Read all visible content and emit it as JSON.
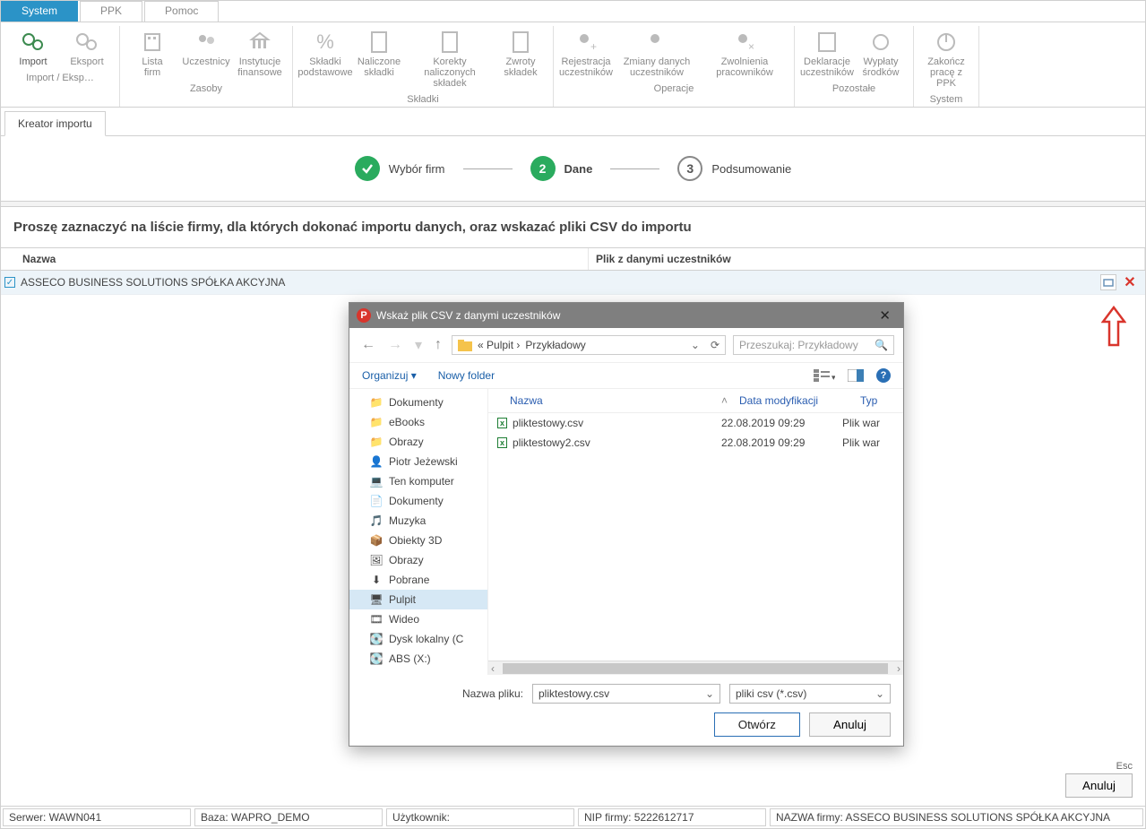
{
  "top_tabs": {
    "system": "System",
    "ppk": "PPK",
    "pomoc": "Pomoc"
  },
  "ribbon": {
    "groups": {
      "import_eksport": {
        "label": "Import / Eksp…",
        "items": [
          {
            "key": "import",
            "label": "Import"
          },
          {
            "key": "eksport",
            "label": "Eksport"
          }
        ]
      },
      "zasoby": {
        "label": "Zasoby",
        "items": [
          {
            "key": "lista_firm",
            "label": "Lista\nfirm"
          },
          {
            "key": "uczestnicy",
            "label": "Uczestnicy"
          },
          {
            "key": "instytucje",
            "label": "Instytucje\nfinansowe"
          }
        ]
      },
      "skladki": {
        "label": "Składki",
        "items": [
          {
            "key": "skladki_podst",
            "label": "Składki\npodstawowe"
          },
          {
            "key": "naliczone",
            "label": "Naliczone\nskładki"
          },
          {
            "key": "korekty",
            "label": "Korekty naliczonych\nskładek"
          },
          {
            "key": "zwroty",
            "label": "Zwroty\nskładek"
          }
        ]
      },
      "operacje": {
        "label": "Operacje",
        "items": [
          {
            "key": "rejestracja",
            "label": "Rejestracja\nuczestników"
          },
          {
            "key": "zmiany",
            "label": "Zmiany danych\nuczestników"
          },
          {
            "key": "zwolnienia",
            "label": "Zwolnienia\npracowników"
          }
        ]
      },
      "pozostale": {
        "label": "Pozostałe",
        "items": [
          {
            "key": "deklaracje",
            "label": "Deklaracje\nuczestników"
          },
          {
            "key": "wyplaty",
            "label": "Wypłaty\nśrodków"
          }
        ]
      },
      "system": {
        "label": "System",
        "items": [
          {
            "key": "zakoncz",
            "label": "Zakończ\npracę z PPK"
          }
        ]
      }
    }
  },
  "content_tab": "Kreator importu",
  "wizard": {
    "step1": "Wybór firm",
    "step2": "Dane",
    "step3": "Podsumowanie",
    "num2": "2",
    "num3": "3"
  },
  "instruction": "Proszę zaznaczyć na liście firmy, dla których dokonać importu danych, oraz wskazać pliki CSV do importu",
  "grid": {
    "headers": {
      "nazwa": "Nazwa",
      "plik": "Plik z danymi uczestników"
    },
    "row0": {
      "name": "ASSECO BUSINESS SOLUTIONS SPÓŁKA AKCYJNA"
    }
  },
  "footer_btn": {
    "key": "Esc",
    "label": "Anuluj"
  },
  "status": {
    "serwer": "Serwer: WAWN041",
    "baza": "Baza: WAPRO_DEMO",
    "uzytkownik": "Użytkownik:",
    "nip": "NIP firmy: 5222612717",
    "nazwa": "NAZWA firmy: ASSECO BUSINESS SOLUTIONS SPÓŁKA AKCYJNA"
  },
  "dialog": {
    "title": "Wskaż plik CSV z danymi uczestników",
    "breadcrumb_prefix": "«  Pulpit  ›  ",
    "breadcrumb_current": "Przykładowy",
    "search_placeholder": "Przeszukaj: Przykładowy",
    "organize": "Organizuj",
    "new_folder": "Nowy folder",
    "tree": [
      {
        "k": "dokumenty",
        "label": "Dokumenty"
      },
      {
        "k": "ebooks",
        "label": "eBooks"
      },
      {
        "k": "obrazy",
        "label": "Obrazy"
      },
      {
        "k": "piotr",
        "label": "Piotr Jeżewski"
      },
      {
        "k": "ten_komputer",
        "label": "Ten komputer"
      },
      {
        "k": "dokumenty2",
        "label": "Dokumenty"
      },
      {
        "k": "muzyka",
        "label": "Muzyka"
      },
      {
        "k": "obiekty3d",
        "label": "Obiekty 3D"
      },
      {
        "k": "obrazy2",
        "label": "Obrazy"
      },
      {
        "k": "pobrane",
        "label": "Pobrane"
      },
      {
        "k": "pulpit",
        "label": "Pulpit",
        "selected": true
      },
      {
        "k": "wideo",
        "label": "Wideo"
      },
      {
        "k": "dysk_c",
        "label": "Dysk lokalny (C"
      },
      {
        "k": "abs_x",
        "label": "ABS (X:)"
      }
    ],
    "columns": {
      "name": "Nazwa",
      "date": "Data modyfikacji",
      "type": "Typ"
    },
    "files": [
      {
        "name": "pliktestowy.csv",
        "date": "22.08.2019 09:29",
        "type": "Plik war"
      },
      {
        "name": "pliktestowy2.csv",
        "date": "22.08.2019 09:29",
        "type": "Plik war"
      }
    ],
    "filename_label": "Nazwa pliku:",
    "filename_value": "pliktestowy.csv",
    "filter": "pliki csv (*.csv)",
    "open": "Otwórz",
    "cancel": "Anuluj"
  }
}
